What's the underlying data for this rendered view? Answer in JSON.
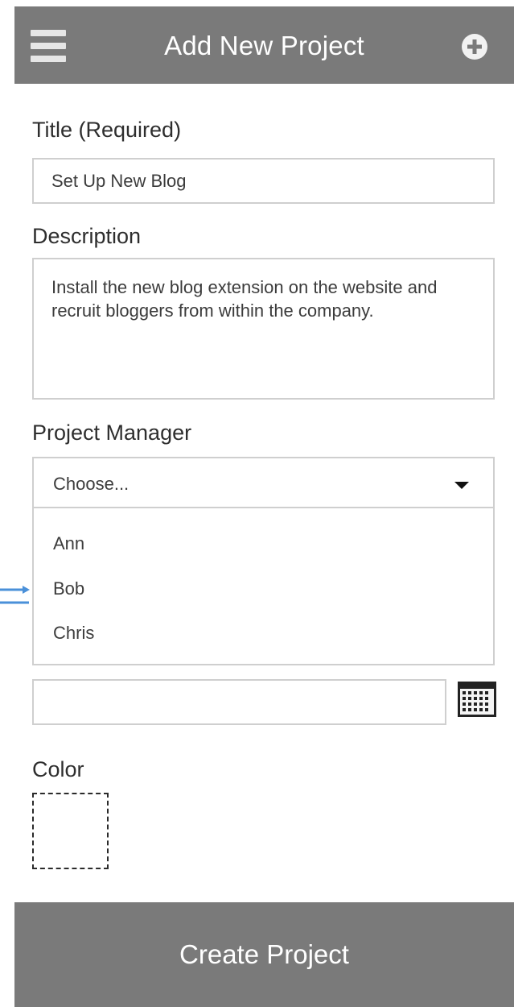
{
  "header": {
    "title": "Add New Project",
    "menu_icon": "hamburger-menu-icon",
    "add_icon": "plus-circle-icon"
  },
  "form": {
    "title_label": "Title (Required)",
    "title_value": "Set Up New Blog",
    "description_label": "Description",
    "description_value": "Install the new blog extension on the website and recruit bloggers from within the company.",
    "manager_label": "Project Manager",
    "manager_selected": "Choose...",
    "manager_options": [
      "Ann",
      "Bob",
      "Chris"
    ],
    "date_value": "",
    "calendar_icon": "calendar-icon",
    "color_label": "Color",
    "create_label": "Create Project"
  },
  "colors": {
    "bar": "#7a7a7a",
    "border": "#cfcfcf",
    "arrow": "#4a90d9"
  }
}
